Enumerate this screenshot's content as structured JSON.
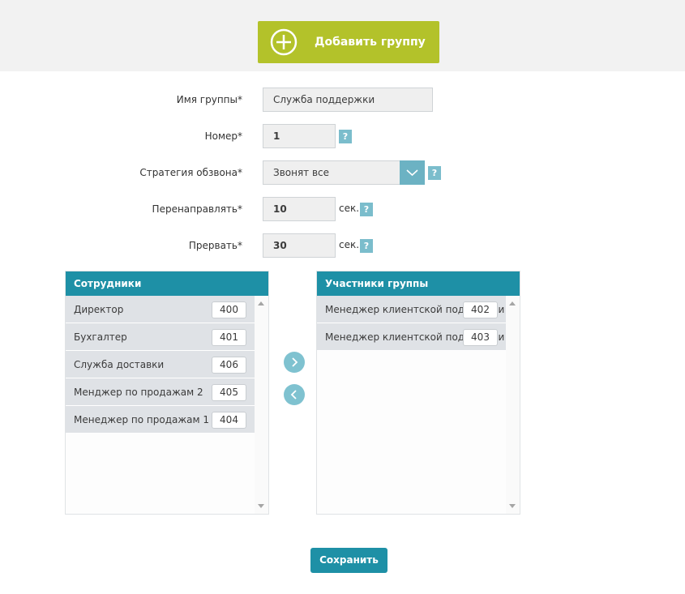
{
  "header": {
    "add_group_label": "Добавить группу"
  },
  "form": {
    "group_name": {
      "label": "Имя группы*",
      "value": "Служба поддержки"
    },
    "number": {
      "label": "Номер*",
      "value": "1"
    },
    "strategy": {
      "label": "Стратегия обзвона*",
      "value": "Звонят все"
    },
    "redirect": {
      "label": "Перенаправлять*",
      "value": "10",
      "unit": "сек."
    },
    "interrupt": {
      "label": "Прервать*",
      "value": "30",
      "unit": "сек."
    },
    "help_glyph": "?"
  },
  "employees": {
    "title": "Сотрудники",
    "items": [
      {
        "name": "Директор",
        "ext": "400"
      },
      {
        "name": "Бухгалтер",
        "ext": "401"
      },
      {
        "name": "Служба доставки",
        "ext": "406"
      },
      {
        "name": "Менджер по продажам 2",
        "ext": "405"
      },
      {
        "name": "Менеджер по продажам 1",
        "ext": "404"
      }
    ]
  },
  "members": {
    "title": "Участники группы",
    "items": [
      {
        "name": "Менеджер клиентской поддержки",
        "ext": "402"
      },
      {
        "name": "Менеджер клиентской поддержки",
        "ext": "403"
      }
    ]
  },
  "footer": {
    "save_label": "Сохранить"
  },
  "colors": {
    "accent": "#b3c22a",
    "primary": "#1e90a6",
    "help": "#7bbdcc"
  }
}
